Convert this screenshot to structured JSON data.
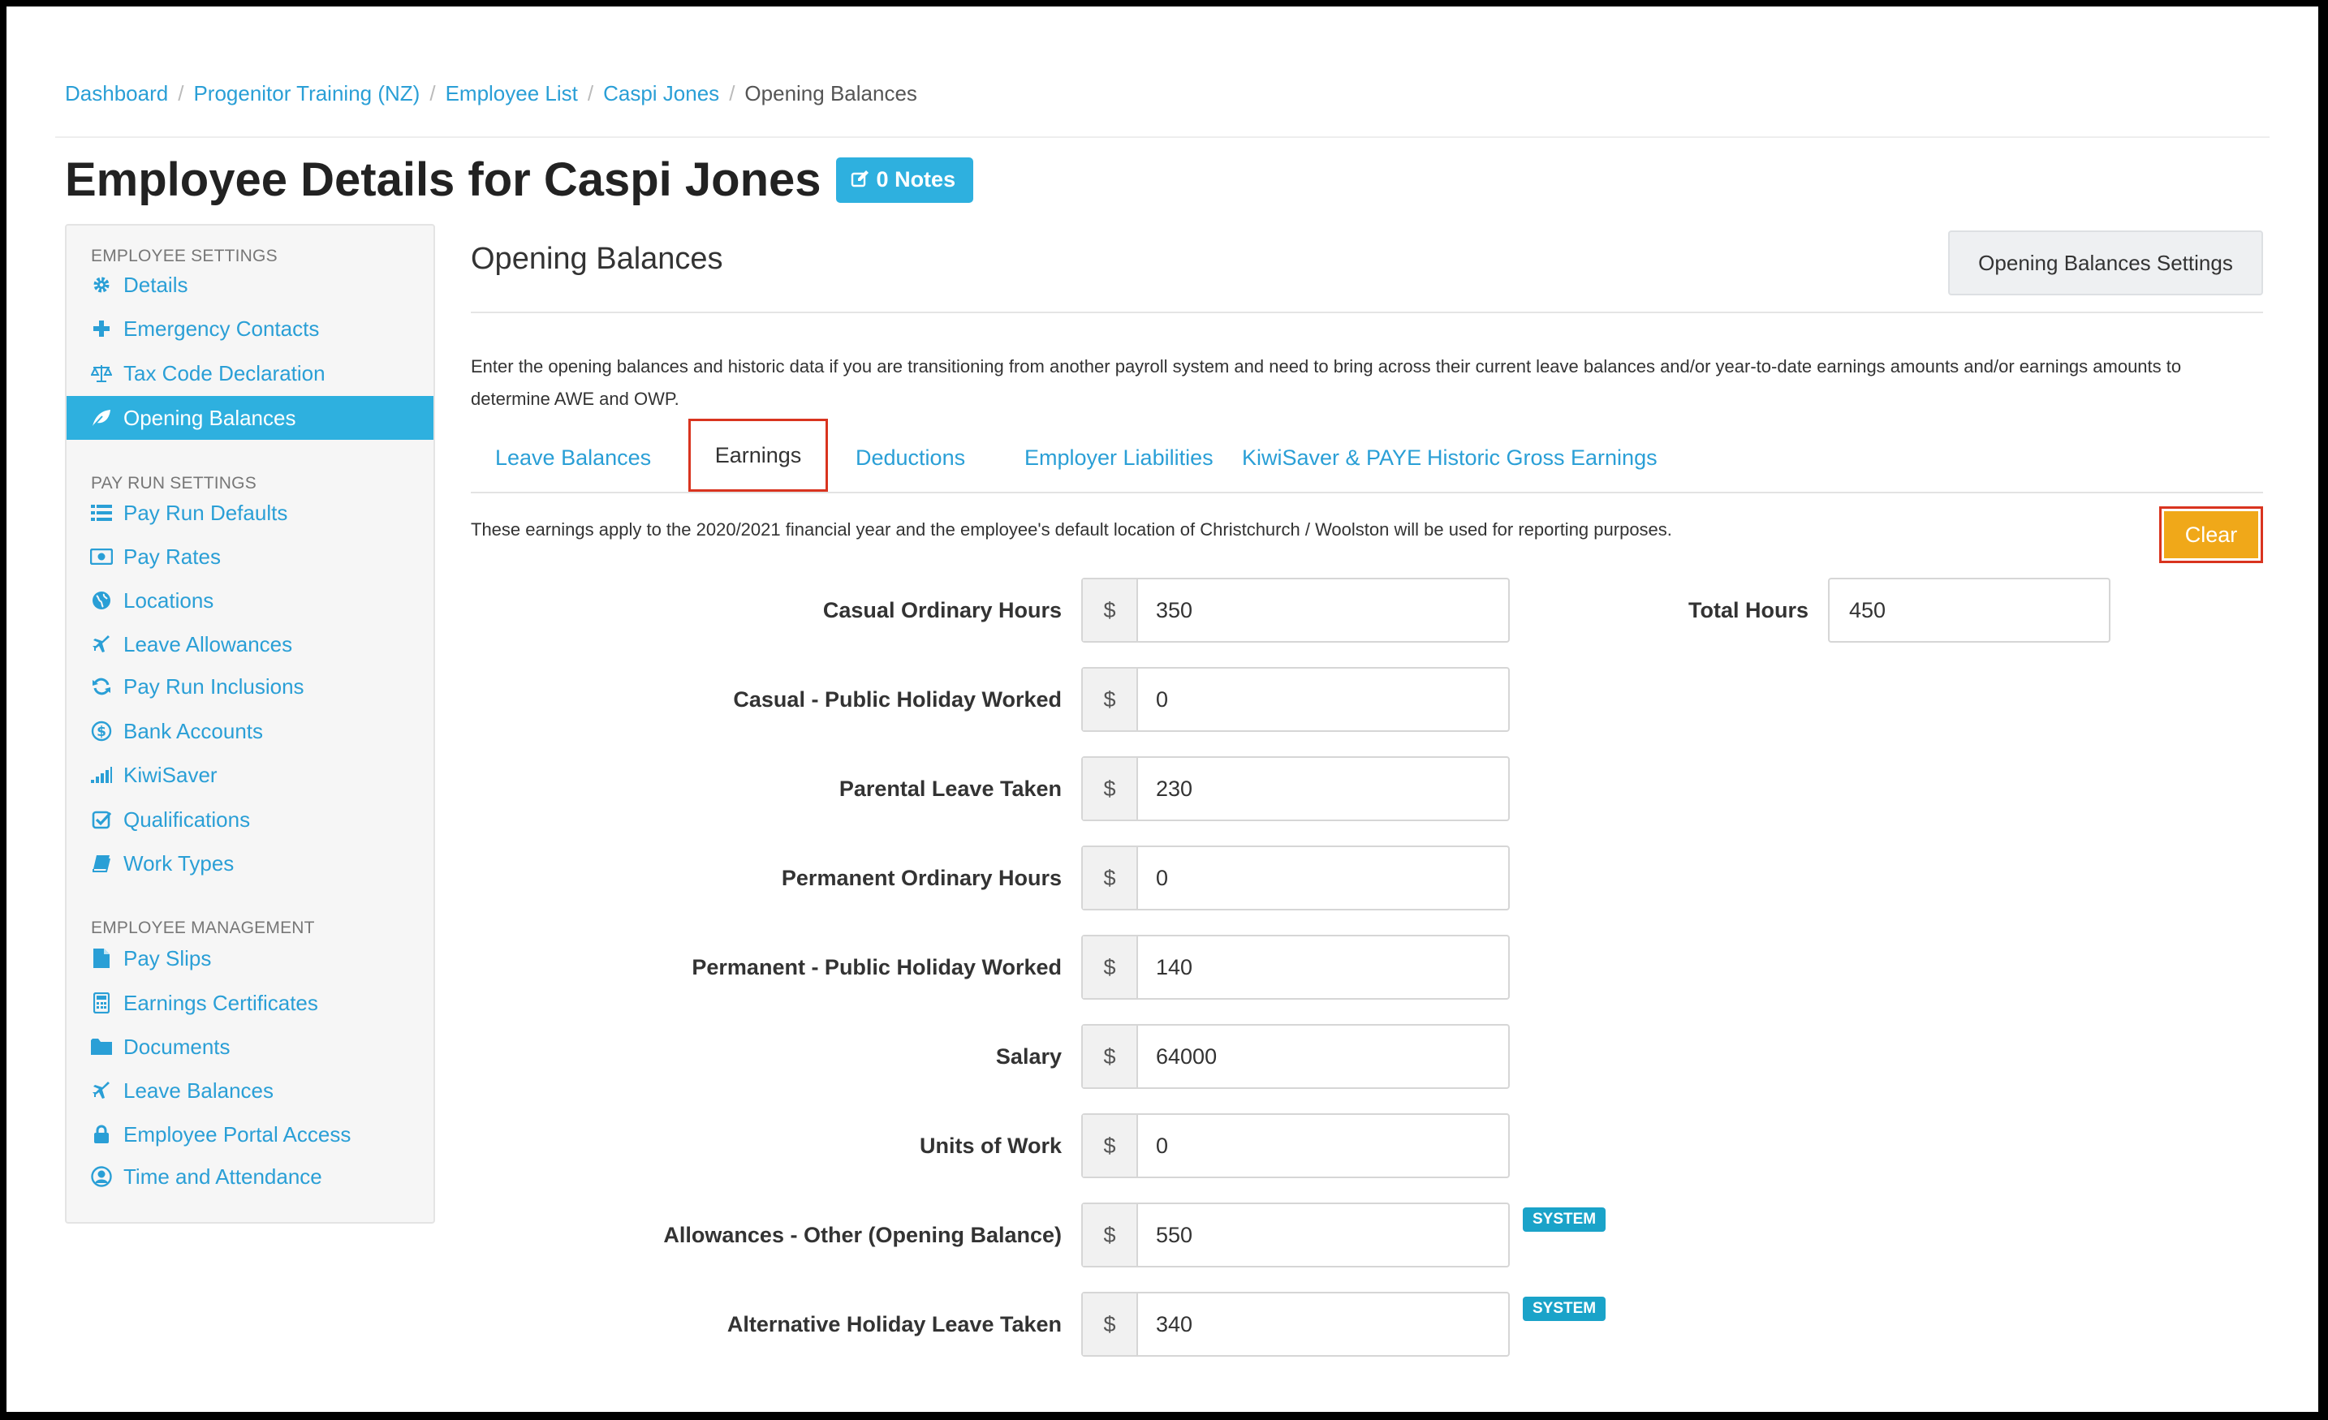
{
  "breadcrumb": [
    "Dashboard",
    "Progenitor Training (NZ)",
    "Employee List",
    "Caspi Jones",
    "Opening Balances"
  ],
  "page_title": "Employee Details for Caspi Jones",
  "notes_button": "0 Notes",
  "sidebar": {
    "sections": [
      {
        "heading": "EMPLOYEE SETTINGS",
        "items": [
          {
            "label": "Details",
            "icon": "gear-icon"
          },
          {
            "label": "Emergency Contacts",
            "icon": "plus-icon"
          },
          {
            "label": "Tax Code Declaration",
            "icon": "scale-icon"
          },
          {
            "label": "Opening Balances",
            "icon": "leaf-icon",
            "active": true
          }
        ]
      },
      {
        "heading": "PAY RUN SETTINGS",
        "items": [
          {
            "label": "Pay Run Defaults",
            "icon": "list-icon"
          },
          {
            "label": "Pay Rates",
            "icon": "money-icon"
          },
          {
            "label": "Locations",
            "icon": "globe-icon"
          },
          {
            "label": "Leave Allowances",
            "icon": "plane-icon"
          },
          {
            "label": "Pay Run Inclusions",
            "icon": "refresh-icon"
          },
          {
            "label": "Bank Accounts",
            "icon": "dollar-circle-icon"
          },
          {
            "label": "KiwiSaver",
            "icon": "signal-icon"
          },
          {
            "label": "Qualifications",
            "icon": "check-square-icon"
          },
          {
            "label": "Work Types",
            "icon": "book-icon"
          }
        ]
      },
      {
        "heading": "EMPLOYEE MANAGEMENT",
        "items": [
          {
            "label": "Pay Slips",
            "icon": "file-icon"
          },
          {
            "label": "Earnings Certificates",
            "icon": "calculator-icon"
          },
          {
            "label": "Documents",
            "icon": "folder-icon"
          },
          {
            "label": "Leave Balances",
            "icon": "plane-icon"
          },
          {
            "label": "Employee Portal Access",
            "icon": "lock-icon"
          },
          {
            "label": "Time and Attendance",
            "icon": "user-circle-icon"
          }
        ]
      }
    ]
  },
  "main": {
    "title": "Opening Balances",
    "settings_button": "Opening Balances Settings",
    "intro": "Enter the opening balances and historic data if you are transitioning from another payroll system and need to bring across their current leave balances and/or year-to-date earnings amounts and/or earnings amounts to determine AWE and OWP.",
    "tabs": [
      "Leave Balances",
      "Earnings",
      "Deductions",
      "Employer Liabilities",
      "KiwiSaver & PAYE",
      "Historic Gross Earnings"
    ],
    "active_tab": "Earnings",
    "earnings_note": "These earnings apply to the 2020/2021 financial year and the employee's default location of Christchurch / Woolston will be used for reporting purposes.",
    "clear_button": "Clear",
    "currency_symbol": "$",
    "total_hours_label": "Total Hours",
    "total_hours_value": "450",
    "rows": [
      {
        "label": "Casual Ordinary Hours",
        "value": "350"
      },
      {
        "label": "Casual - Public Holiday Worked",
        "value": "0"
      },
      {
        "label": "Parental Leave Taken",
        "value": "230"
      },
      {
        "label": "Permanent Ordinary Hours",
        "value": "0"
      },
      {
        "label": "Permanent - Public Holiday Worked",
        "value": "140"
      },
      {
        "label": "Salary",
        "value": "64000"
      },
      {
        "label": "Units of Work",
        "value": "0"
      },
      {
        "label": "Allowances - Other (Opening Balance)",
        "value": "550",
        "badge": "SYSTEM"
      },
      {
        "label": "Alternative Holiday Leave Taken",
        "value": "340",
        "badge": "SYSTEM"
      }
    ]
  },
  "colors": {
    "accent": "#2eb0df",
    "link": "#2a9fd6",
    "highlight_border": "#d9341f",
    "clear_button": "#f0a819",
    "badge": "#1aa3c9"
  }
}
